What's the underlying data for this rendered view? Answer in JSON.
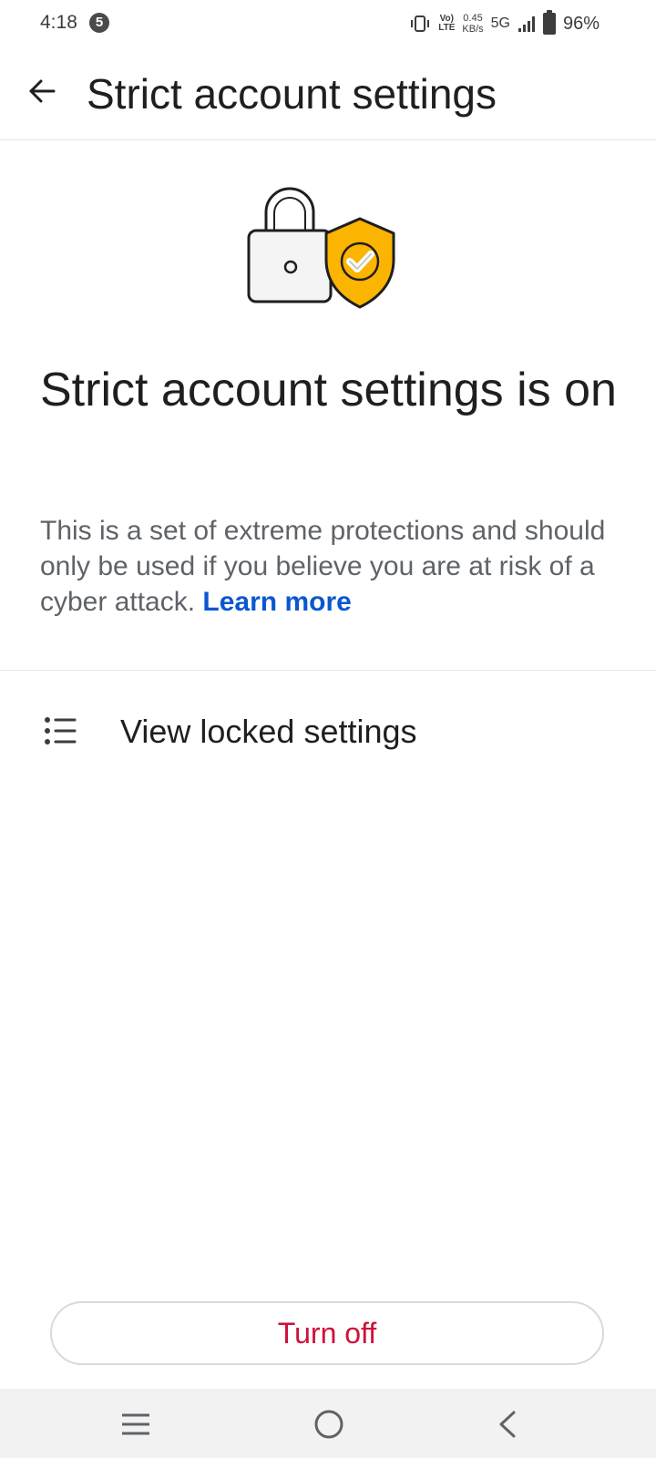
{
  "status_bar": {
    "time": "4:18",
    "notification_count": "5",
    "volte_top": "Vo)",
    "volte_bottom": "LTE",
    "speed_value": "0.45",
    "speed_unit": "KB/s",
    "network": "5G",
    "battery": "96%"
  },
  "app_bar": {
    "title": "Strict account settings",
    "back_icon": "arrow-back-icon"
  },
  "hero": {
    "icons": [
      "lock-icon",
      "shield-check-icon"
    ],
    "shield_color": "#FBB400"
  },
  "main": {
    "headline": "Strict account settings is on",
    "description": "This is a set of extreme protections and should only be used if you believe you are at risk of a cyber attack.",
    "learn_more": "Learn more",
    "link_color": "#0B57D0"
  },
  "locked_settings": {
    "label": "View locked settings",
    "icon": "list-icon"
  },
  "turn_off": {
    "label": "Turn off",
    "color": "#D0103A"
  },
  "nav_bar": {
    "icons": [
      "recent-apps-icon",
      "home-icon",
      "back-nav-icon"
    ]
  }
}
